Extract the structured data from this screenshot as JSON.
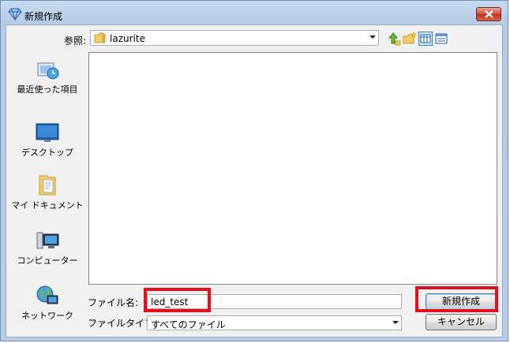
{
  "window": {
    "title": "新規作成",
    "close_icon": "close-icon"
  },
  "lookin": {
    "label": "参照:",
    "value": "lazurite"
  },
  "toolbar": {
    "icons": [
      "up-folder-icon",
      "new-folder-icon",
      "view-menu-icon",
      "details-view-icon"
    ]
  },
  "places": [
    {
      "label": "最近使った項目",
      "icon": "recent-items-icon"
    },
    {
      "label": "デスクトップ",
      "icon": "desktop-icon"
    },
    {
      "label": "マイ ドキュメント",
      "icon": "documents-icon"
    },
    {
      "label": "コンピューター",
      "icon": "computer-icon"
    },
    {
      "label": "ネットワーク",
      "icon": "network-icon"
    }
  ],
  "filename": {
    "label": "ファイル名:",
    "value": "led_test"
  },
  "filetype": {
    "label": "ファイルタイプ:",
    "value": "すべてのファイル"
  },
  "buttons": {
    "create": "新規作成",
    "cancel": "キャンセル"
  },
  "colors": {
    "highlight": "#e0101e",
    "accent": "#3c7fb1"
  }
}
